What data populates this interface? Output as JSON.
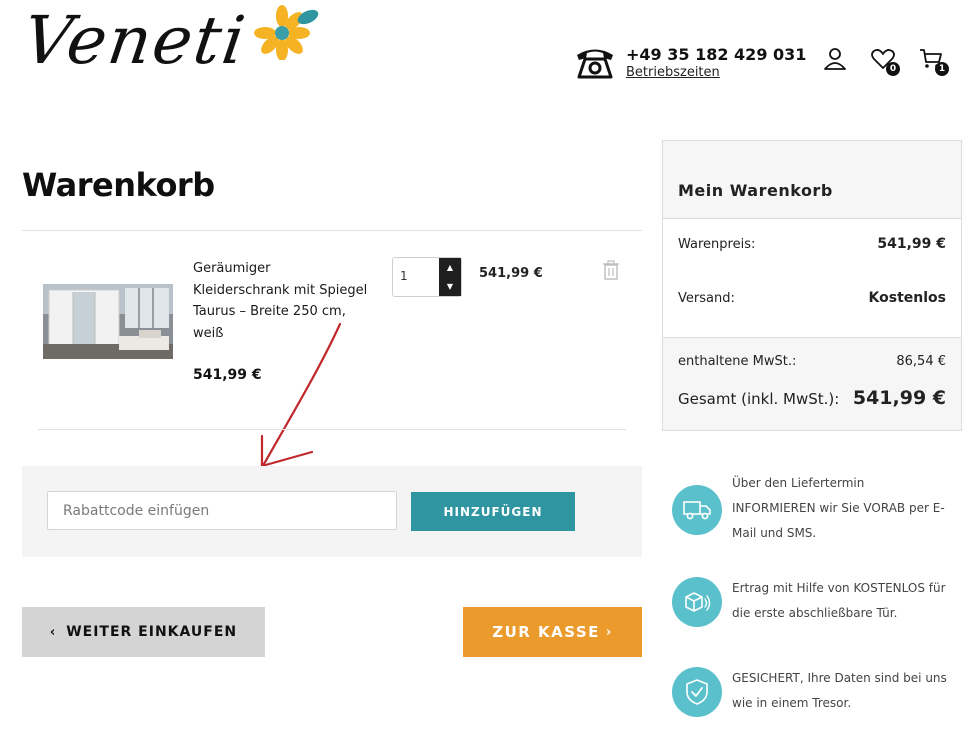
{
  "header": {
    "logo_text": "Veneti",
    "phone_number": "+49 35 182 429 031",
    "phone_hours_label": "Betriebszeiten",
    "wishlist_count": "0",
    "cart_count": "1"
  },
  "cart": {
    "title": "Warenkorb",
    "items": [
      {
        "name": "Geräumiger Kleiderschrank mit Spiegel Taurus – Breite 250 cm, weiß",
        "quantity": "1",
        "price": "541,99 €",
        "line_total": "541,99 €"
      }
    ],
    "coupon": {
      "placeholder": "Rabattcode einfügen",
      "button_label": "HINZUFÜGEN"
    },
    "continue_label": "WEITER EINKAUFEN",
    "checkout_label": "ZUR KASSE"
  },
  "summary": {
    "title": "Mein Warenkorb",
    "product_price_label": "Warenpreis:",
    "product_price_value": "541,99 €",
    "shipping_label": "Versand:",
    "shipping_value": "Kostenlos",
    "tax_label": "enthaltene MwSt.:",
    "tax_value": "86,54 €",
    "total_label": "Gesamt (inkl. MwSt.):",
    "total_value": "541,99 €"
  },
  "info": [
    {
      "icon": "truck-icon",
      "text": "Über den Liefertermin INFORMIEREN wir Sie VORAB per E-Mail und SMS."
    },
    {
      "icon": "package-icon",
      "text": "Ertrag mit Hilfe von KOSTENLOS für die erste abschließbare Tür."
    },
    {
      "icon": "shield-check-icon",
      "text": "GESICHERT, Ihre Daten sind bei uns wie in einem Tresor."
    }
  ],
  "colors": {
    "teal": "#2f95a1",
    "orange": "#eb9b2b",
    "info_circle": "#5ac0cb",
    "annotation_red": "#c0282b"
  }
}
